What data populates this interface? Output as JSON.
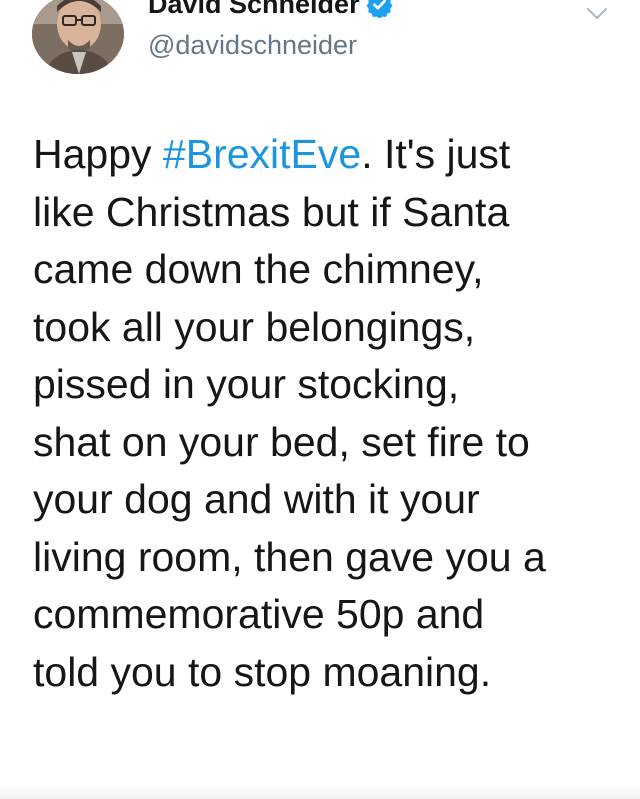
{
  "tweet": {
    "display_name": "David Schneider",
    "handle": "@davidschneider",
    "verified": true,
    "body": {
      "prefix": "Happy ",
      "hashtag": "#BrexitEve",
      "suffix": ". It's just\nlike Christmas but if Santa\ncame down the chimney,\ntook all your belongings,\npissed in your stocking,\nshat on your bed, set fire to\nyour dog and with it your\nliving room, then gave you a\ncommemorative 50p and\ntold you to stop moaning."
    }
  },
  "icons": {
    "verified": "verified-badge-icon",
    "more": "chevron-down-icon",
    "avatar": "avatar"
  },
  "colors": {
    "text": "#14171a",
    "secondary": "#657786",
    "link": "#1b95e0",
    "verified": "#1da1f2"
  }
}
